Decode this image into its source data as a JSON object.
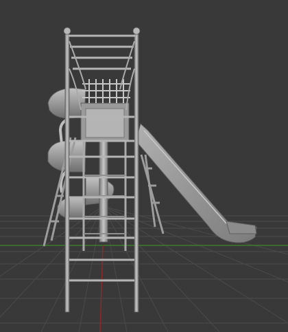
{
  "viewport": {
    "background": "#393939",
    "grid_color": "#4a4a4a",
    "x_axis_color": "#3d7a2e",
    "y_axis_color": "#8a2a2a",
    "model_color": "#a3a3a3",
    "model_dark": "#6e6e6e",
    "model_light": "#c4c4c4"
  }
}
